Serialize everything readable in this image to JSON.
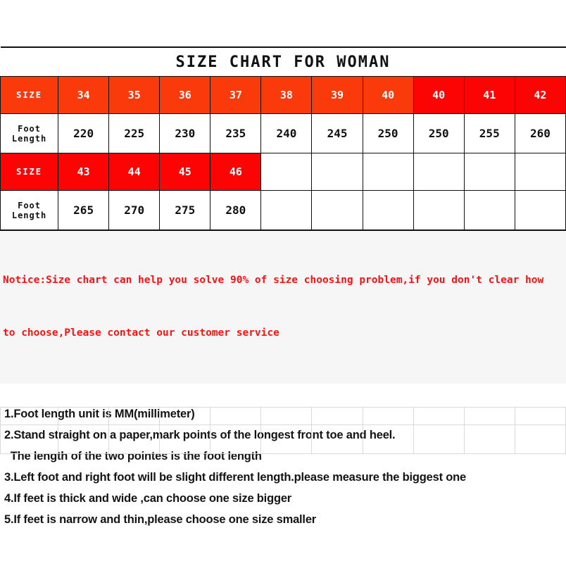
{
  "table": {
    "title": "SIZE CHART FOR WOMAN",
    "label_size": "SIZE",
    "label_foot_length": "Foot Length",
    "colors": {
      "header_orange": "#fb3a0b",
      "header_red": "#fc0404",
      "notice_text": "#fb1111",
      "notice_background": "#f6f6f6",
      "grid_line": "#111111",
      "faint_grid_line": "#d9d9d9"
    },
    "row1": {
      "sizes": [
        "34",
        "35",
        "36",
        "37",
        "38",
        "39",
        "40",
        "40",
        "41",
        "42"
      ],
      "size_colors": [
        "orange",
        "orange",
        "orange",
        "orange",
        "orange",
        "orange",
        "orange",
        "red",
        "red",
        "red"
      ],
      "foot_lengths": [
        "220",
        "225",
        "230",
        "235",
        "240",
        "245",
        "250",
        "250",
        "255",
        "260"
      ]
    },
    "row2": {
      "sizes": [
        "43",
        "44",
        "45",
        "46",
        "",
        "",
        "",
        "",
        "",
        ""
      ],
      "size_colors": [
        "red",
        "red",
        "red",
        "red",
        "empty",
        "empty",
        "empty",
        "empty",
        "empty",
        "empty"
      ],
      "foot_lengths": [
        "265",
        "270",
        "275",
        "280",
        "",
        "",
        "",
        "",
        "",
        ""
      ]
    }
  },
  "notice": {
    "line1": "Notice:Size chart can help you solve 90% of size choosing problem,if you don't clear how",
    "line2": "to choose,Please contact our customer service"
  },
  "instructions": {
    "items": [
      "1.Foot length unit is MM(millimeter)",
      "2.Stand straight on a paper,mark points of the longest front toe and heel.",
      "  The length of the two pointes is the foot length",
      "3.Left foot and right foot will be slight different length.please measure the biggest one",
      "4.If feet is thick and wide ,can choose one size bigger",
      "5.If feet is narrow and thin,please choose one size smaller"
    ]
  },
  "empty_grid": {
    "rows": 2,
    "cols": 11
  },
  "chart_data": {
    "type": "table",
    "title": "SIZE CHART FOR WOMAN",
    "columns": [
      "SIZE",
      "Foot Length (MM)"
    ],
    "rows": [
      [
        "34",
        220
      ],
      [
        "35",
        225
      ],
      [
        "36",
        230
      ],
      [
        "37",
        235
      ],
      [
        "38",
        240
      ],
      [
        "39",
        245
      ],
      [
        "40",
        250
      ],
      [
        "40",
        250
      ],
      [
        "41",
        255
      ],
      [
        "42",
        260
      ],
      [
        "43",
        265
      ],
      [
        "44",
        270
      ],
      [
        "45",
        275
      ],
      [
        "46",
        280
      ]
    ],
    "xlabel": "SIZE",
    "ylabel": "Foot Length (MM)",
    "ylim": [
      220,
      280
    ]
  }
}
